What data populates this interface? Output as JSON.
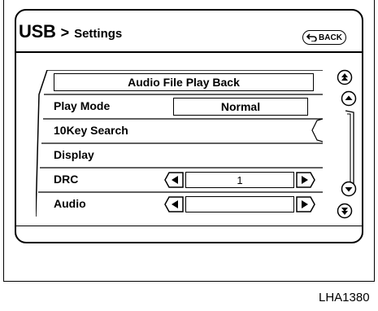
{
  "header": {
    "source": "USB",
    "separator": ">",
    "title": "Settings",
    "back_label": "BACK"
  },
  "menu": {
    "heading": "Audio File Play Back",
    "items": [
      {
        "label": "Play Mode",
        "value": "Normal"
      },
      {
        "label": "10Key Search"
      },
      {
        "label": "Display"
      },
      {
        "label": "DRC",
        "value": "1"
      },
      {
        "label": "Audio",
        "value": ""
      }
    ]
  },
  "figure_code": "LHA1380"
}
